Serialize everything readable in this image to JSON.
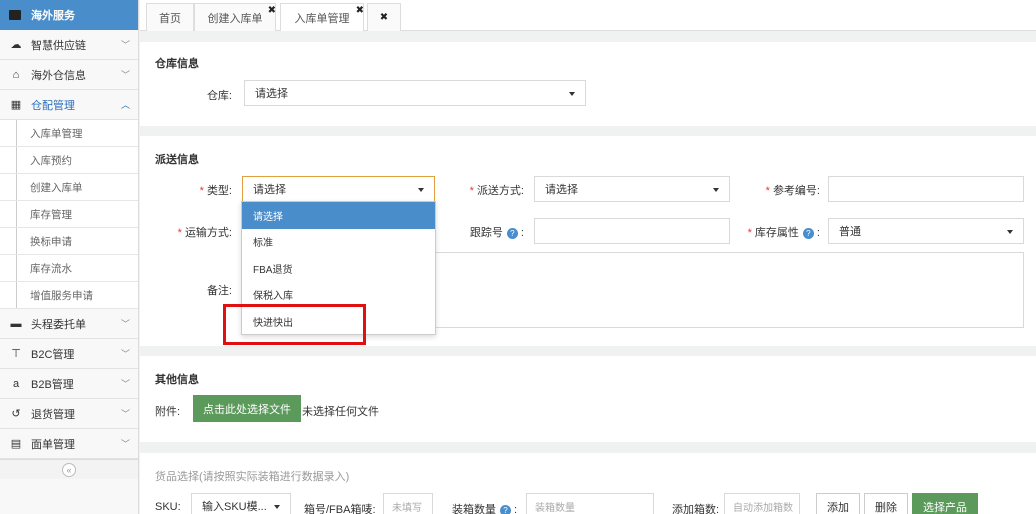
{
  "sidebar": {
    "header": "海外服务",
    "items": [
      {
        "label": "智慧供应链",
        "icon": "☁"
      },
      {
        "label": "海外仓信息",
        "icon": "⌂"
      },
      {
        "label": "仓配管理",
        "icon": "▦"
      }
    ],
    "subitems": [
      "入库单管理",
      "入库预约",
      "创建入库单",
      "库存管理",
      "换标申请",
      "库存流水",
      "增值服务申请"
    ],
    "items2": [
      {
        "label": "头程委托单",
        "icon": "▬"
      },
      {
        "label": "B2C管理",
        "icon": "⊤"
      },
      {
        "label": "B2B管理",
        "icon": "a"
      },
      {
        "label": "退货管理",
        "icon": "↺"
      },
      {
        "label": "面单管理",
        "icon": "▤"
      }
    ],
    "collapse": "«"
  },
  "tabs": {
    "home": "首页",
    "create": "创建入库单",
    "manage": "入库单管理",
    "close": "✖"
  },
  "warehouse": {
    "title": "仓库信息",
    "label": "仓库:",
    "value": "请选择"
  },
  "delivery": {
    "title": "派送信息",
    "type_label": "类型:",
    "type_value": "请选择",
    "method_label": "派送方式:",
    "method_value": "请选择",
    "ref_label": "参考编号:",
    "transport_label": "运输方式:",
    "tracking_label": "跟踪号",
    "stock_label": "库存属性",
    "stock_value": "普通",
    "remark_label": "备注:",
    "required_mark": "*",
    "help": "?"
  },
  "dropdown": {
    "options": [
      "请选择",
      "标准",
      "FBA退货",
      "保税入库",
      "快进快出"
    ]
  },
  "other": {
    "title": "其他信息",
    "attach_label": "附件:",
    "upload_button": "点击此处选择文件",
    "no_file": "未选择任何文件"
  },
  "goods": {
    "title": "货品选择(请按照实际装箱进行数据录入)",
    "sku_label": "SKU:",
    "sku_select": "输入SKU模...",
    "box_label": "箱号/FBA箱唛:",
    "box_placeholder": "未填写",
    "qty_label": "装箱数量",
    "qty_placeholder": "装箱数量",
    "add_box_label": "添加箱数:",
    "add_box_placeholder": "自动添加箱数",
    "add_button": "添加",
    "delete_button": "删除",
    "select_button": "选择产品"
  },
  "colors": {
    "accent": "#4a8dcb",
    "green": "#5b9a5b",
    "highlight": "#e01010"
  }
}
